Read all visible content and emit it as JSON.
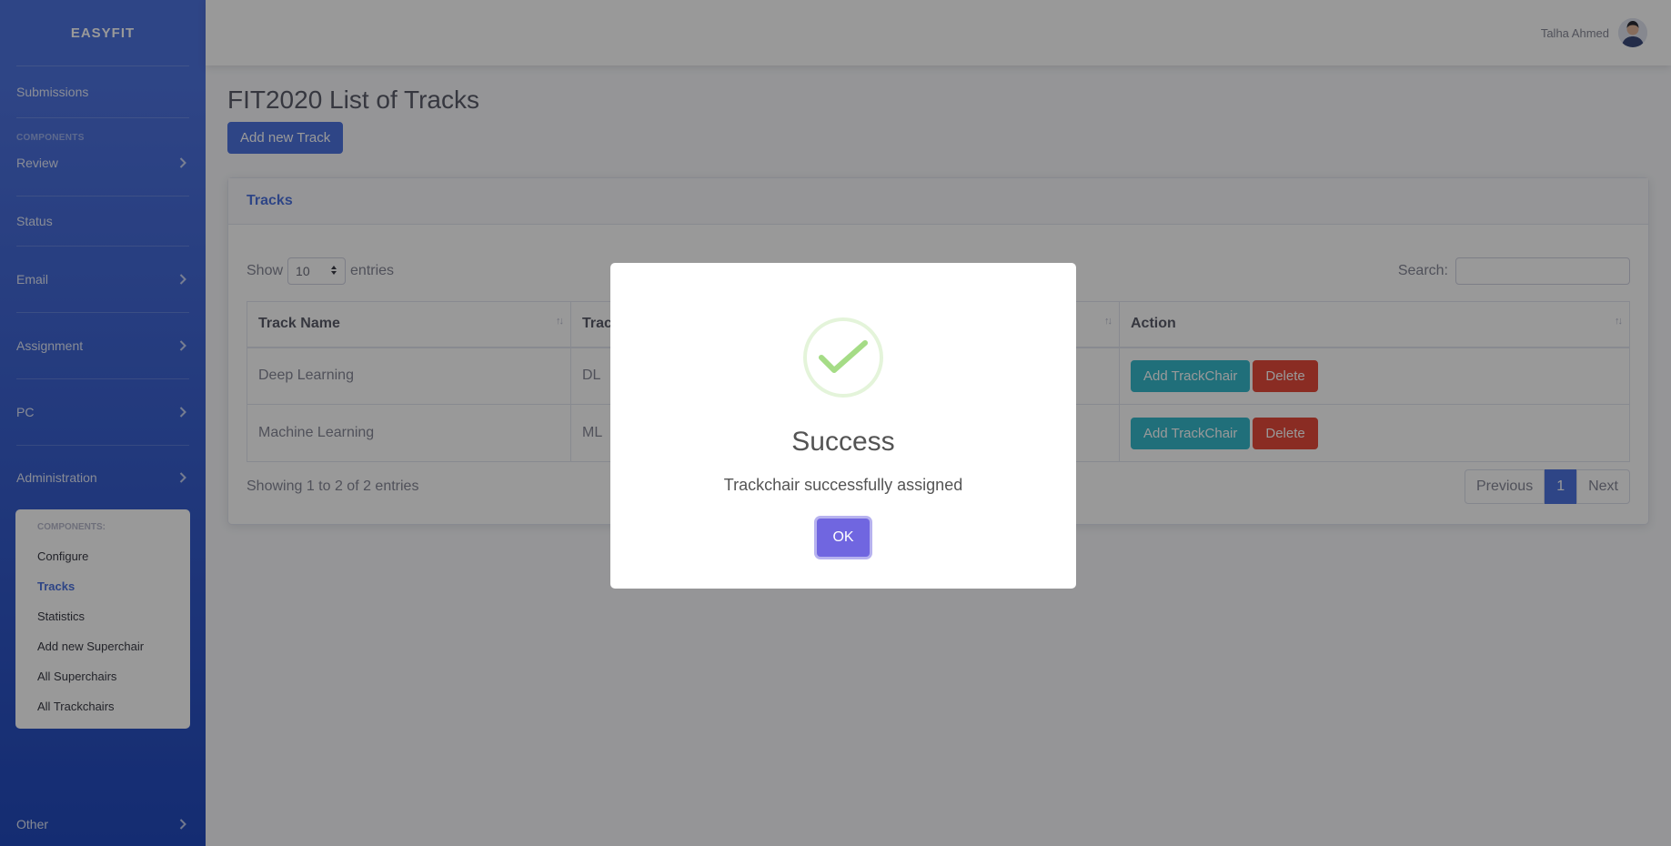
{
  "sidebar": {
    "brand": "EASYFIT",
    "submissions": "Submissions",
    "components_heading": "COMPONENTS",
    "items": {
      "review": "Review",
      "status": "Status",
      "email": "Email",
      "assignment": "Assignment",
      "pc": "PC",
      "administration": "Administration",
      "other": "Other"
    },
    "submenu": {
      "heading": "COMPONENTS:",
      "configure": "Configure",
      "tracks": "Tracks",
      "statistics": "Statistics",
      "add_superchair": "Add new Superchair",
      "all_superchairs": "All Superchairs",
      "all_trackchairs": "All Trackchairs"
    }
  },
  "topbar": {
    "user_name": "Talha Ahmed"
  },
  "main": {
    "title": "FIT2020 List of Tracks",
    "add_button": "Add new Track",
    "card_title": "Tracks",
    "show_label": "Show",
    "entries_value": "10",
    "entries_label": "entries",
    "search_label": "Search:",
    "columns": {
      "track_name": "Track Name",
      "track_code": "Trac",
      "action": "Action"
    },
    "rows": [
      {
        "name": "Deep Learning",
        "code": "DL",
        "add_btn": "Add TrackChair",
        "delete_btn": "Delete"
      },
      {
        "name": "Machine Learning",
        "code": "ML",
        "add_btn": "Add TrackChair",
        "delete_btn": "Delete"
      }
    ],
    "info": "Showing 1 to 2 of 2 entries",
    "pagination": {
      "previous": "Previous",
      "page": "1",
      "next": "Next"
    }
  },
  "modal": {
    "title": "Success",
    "text": "Trackchair successfully assigned",
    "ok": "OK"
  },
  "colors": {
    "primary": "#4e73df",
    "info": "#36b9cc",
    "danger": "#e74a3b",
    "confirm": "#7066e0",
    "success": "#a5dc86"
  }
}
